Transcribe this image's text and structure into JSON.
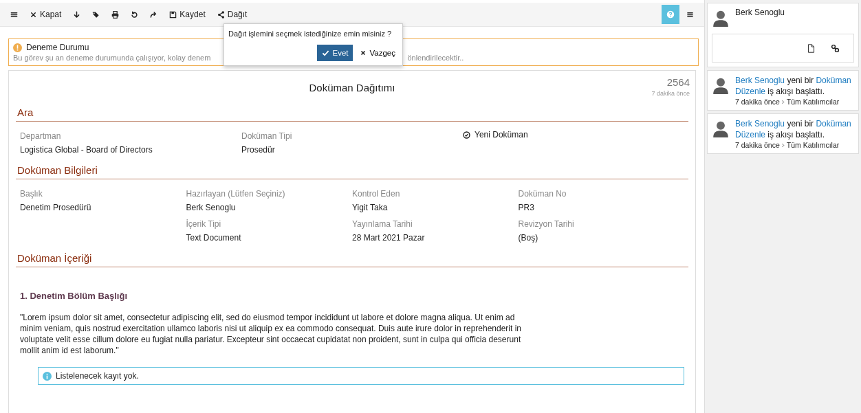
{
  "toolbar": {
    "items": [
      {
        "kind": "menu"
      },
      {
        "kind": "close",
        "label": "Kapat"
      },
      {
        "kind": "down"
      },
      {
        "kind": "tags"
      },
      {
        "kind": "print"
      },
      {
        "kind": "undo"
      },
      {
        "kind": "redo"
      },
      {
        "kind": "save",
        "label": "Kaydet"
      },
      {
        "kind": "share",
        "label": "Dağıt"
      }
    ]
  },
  "confirm": {
    "question": "Dağıt işlemini seçmek istediğinize emin misiniz ?",
    "yes": "Evet",
    "no": "Vazgeç"
  },
  "alert": {
    "title": "Deneme Durumu",
    "text_start": "Bu görev şu an deneme durumunda çalışıyor, kolay denem",
    "text_end": "önlendirilecektir.."
  },
  "form": {
    "title": "Doküman Dağıtımı",
    "number": "2564",
    "time": "7 dakika önce",
    "sections": [
      {
        "title": "Ara",
        "fields": [
          {
            "kind": "field",
            "label": "Departman",
            "value": "Logistica Global - Board of Directors"
          },
          {
            "kind": "field",
            "label": "Doküman Tipi",
            "value": "Prosedür"
          },
          {
            "kind": "check",
            "label": "Yeni Doküman",
            "checked": true
          }
        ]
      },
      {
        "title": "Doküman Bilgileri",
        "fields": [
          {
            "kind": "field",
            "label": "Başlık",
            "value": "Denetim Prosedürü"
          },
          {
            "kind": "field",
            "label": "Hazırlayan (Lütfen Seçiniz)",
            "value": "Berk Senoglu"
          },
          {
            "kind": "field",
            "label": "Kontrol Eden",
            "value": "Yigit Taka"
          },
          {
            "kind": "field",
            "label": "Doküman No",
            "value": "PR3"
          },
          {
            "kind": "blank"
          },
          {
            "kind": "field",
            "label": "İçerik Tipi",
            "value": "Text Document"
          },
          {
            "kind": "field",
            "label": "Yayınlama Tarihi",
            "value": "28 Mart 2021 Pazar"
          },
          {
            "kind": "field",
            "label": "Revizyon Tarihi",
            "value": "(Boş)"
          }
        ]
      },
      {
        "title": "Doküman İçeriği"
      }
    ],
    "content": {
      "heading": "1.  Denetim Bölüm Başlığı",
      "paragraph": "\"Lorem ipsum dolor sit amet, consectetur adipiscing elit, sed do eiusmod tempor incididunt ut labore et dolore magna aliqua. Ut enim ad minim veniam, quis nostrud exercitation ullamco laboris nisi ut aliquip ex ea commodo consequat. Duis aute irure dolor in reprehenderit in voluptate velit esse cillum dolore eu fugiat nulla pariatur. Excepteur sint occaecat cupidatat non proident, sunt in culpa qui officia deserunt mollit anim id est laborum.\"",
      "info": "Listelenecek kayıt yok."
    }
  },
  "sidebar": {
    "user": "Berk Senoglu",
    "activities": [
      {
        "user": "Berk Senoglu",
        "mid": " yeni bir ",
        "flow": "Doküman Düzenle",
        "end": " iş akışı başlattı.",
        "time": "7 dakika önce",
        "target": "Tüm Katılımcılar"
      },
      {
        "user": "Berk Senoglu",
        "mid": " yeni bir ",
        "flow": "Doküman Düzenle",
        "end": " iş akışı başlattı.",
        "time": "7 dakika önce",
        "target": "Tüm Katılımcılar"
      }
    ]
  }
}
